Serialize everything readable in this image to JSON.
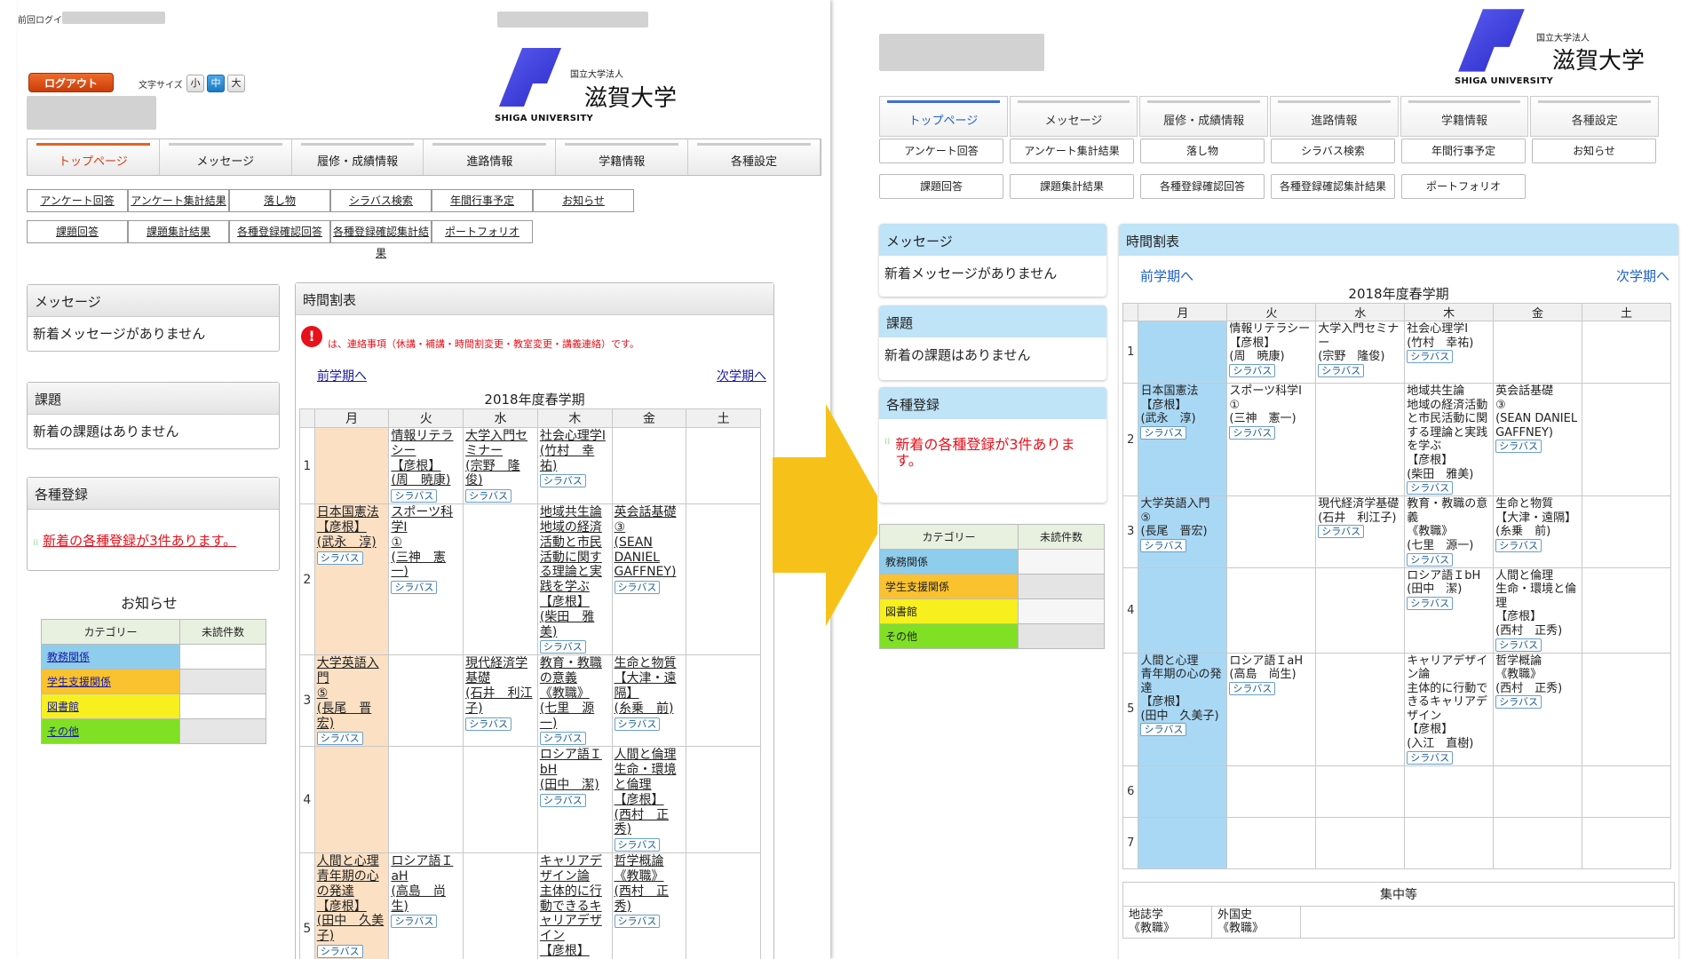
{
  "old_ui": {
    "last_login_label": "前回ログイン",
    "logout_label": "ログアウト",
    "font_size_label": "文字サイズ",
    "font_sizes": [
      "小",
      "中",
      "大"
    ],
    "university": {
      "small": "国立大学法人",
      "big": "滋賀大学",
      "en": "SHIGA UNIVERSITY"
    },
    "tabs": [
      "トップページ",
      "メッセージ",
      "履修・成績情報",
      "進路情報",
      "学籍情報",
      "各種設定"
    ],
    "subnav_row1": [
      "アンケート回答",
      "アンケート集計結果",
      "落し物",
      "シラバス検索",
      "年間行事予定",
      "お知らせ"
    ],
    "subnav_row2": [
      "課題回答",
      "課題集計結果",
      "各種登録確認回答",
      "各種登録確認集計結果",
      "ポートフォリオ"
    ],
    "message_box": {
      "title": "メッセージ",
      "body": "新着メッセージがありません"
    },
    "task_box": {
      "title": "課題",
      "body": "新着の課題はありません"
    },
    "registration_box": {
      "title": "各種登録",
      "body": "新着の各種登録が3件あります。"
    },
    "notice": {
      "title": "お知らせ",
      "headers": [
        "カテゴリー",
        "未読件数"
      ],
      "categories": [
        "教務関係",
        "学生支援関係",
        "図書館",
        "その他"
      ]
    },
    "timetable": {
      "box_title": "時間割表",
      "note": "は、連絡事項（休講・補講・時間割変更・教室変更・講義連絡）です。",
      "prev": "前学期へ",
      "next": "次学期へ",
      "term": "2018年度春学期",
      "days": [
        "月",
        "火",
        "水",
        "木",
        "金",
        "土"
      ],
      "syllabus": "シラバス"
    }
  },
  "new_ui": {
    "university": {
      "small": "国立大学法人",
      "big": "滋賀大学",
      "en": "SHIGA UNIVERSITY"
    },
    "tabs": [
      "トップページ",
      "メッセージ",
      "履修・成績情報",
      "進路情報",
      "学籍情報",
      "各種設定"
    ],
    "subnav_row1": [
      "アンケート回答",
      "アンケート集計結果",
      "落し物",
      "シラバス検索",
      "年間行事予定",
      "お知らせ"
    ],
    "subnav_row2": [
      "課題回答",
      "課題集計結果",
      "各種登録確認回答",
      "各種登録確認集計結果",
      "ポートフォリオ"
    ],
    "message_box": {
      "title": "メッセージ",
      "body": "新着メッセージがありません"
    },
    "task_box": {
      "title": "課題",
      "body": "新着の課題はありません"
    },
    "registration_box": {
      "title": "各種登録",
      "body": "新着の各種登録が3件あります。"
    },
    "notice": {
      "headers": [
        "カテゴリー",
        "未読件数"
      ],
      "categories": [
        "教務関係",
        "学生支援関係",
        "図書館",
        "その他"
      ]
    },
    "timetable": {
      "box_title": "時間割表",
      "prev": "前学期へ",
      "next": "次学期へ",
      "term": "2018年度春学期",
      "days": [
        "月",
        "火",
        "水",
        "木",
        "金",
        "土"
      ],
      "syllabus": "シラバス",
      "periods": [
        "1",
        "2",
        "3",
        "4",
        "5",
        "6",
        "7"
      ],
      "intensive_title": "集中等",
      "intensive": [
        "地誌学\n《教職》",
        "外国史\n《教職》"
      ]
    }
  },
  "timetable_cells": {
    "p1": {
      "火": "情報リテラシー\n【彦根】\n(周　暁康)",
      "水": "大学入門セミナー\n(宗野　隆俊)",
      "木": "社会心理学Ⅰ\n(竹村　幸祐)"
    },
    "p2": {
      "月": "日本国憲法\n【彦根】\n(武永　淳)",
      "火": "スポーツ科学Ⅰ\n①\n(三神　憲一)",
      "木": "地域共生論\n地域の経済活動と市民活動に関する理論と実践を学ぶ\n【彦根】\n(柴田　雅美)",
      "金": "英会話基礎\n③\n(SEAN DANIEL GAFFNEY)"
    },
    "p3": {
      "月": "大学英語入門\n⑤\n(長尾　晋宏)",
      "水": "現代経済学基礎\n(石井　利江子)",
      "木": "教育・教職の意義\n《教職》\n(七里　源一)",
      "金": "生命と物質\n【大津・遠隔】\n(糸乗　前)"
    },
    "p4": {
      "木": "ロシア語ＩbH\n(田中　潔)",
      "金": "人間と倫理\n生命・環境と倫理\n【彦根】\n(西村　正秀)"
    },
    "p5": {
      "月": "人間と心理\n青年期の心の発達\n【彦根】\n(田中　久美子)",
      "火": "ロシア語ＩaH\n(高島　尚生)",
      "木": "キャリアデザイン論\n主体的に行動できるキャリアデザイン\n【彦根】\n(入江　直樹)",
      "金": "哲学概論\n《教職》\n(西村　正秀)"
    }
  },
  "colors": {
    "old_accent": "#e0651d",
    "new_accent": "#3f6fd2",
    "new_header_bg": "#bfe3f7",
    "monday_bg_old": "#fbe0c4",
    "monday_bg_new": "#a9d8f5",
    "alert_red": "#e8101a",
    "arrow": "#f6c21a",
    "cat_kyomu": "#8ecdec",
    "cat_gakusei": "#f9c22e",
    "cat_tosho": "#f7f01e",
    "cat_sonota": "#7fe024"
  }
}
